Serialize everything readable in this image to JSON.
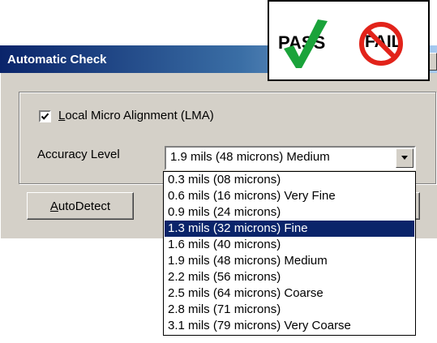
{
  "window": {
    "title": "Automatic Check",
    "close_glyph": "×"
  },
  "lma": {
    "checked": true,
    "label": "Local Micro Alignment (LMA)"
  },
  "accuracy": {
    "label": "Accuracy Level",
    "selected_value": "1.9 mils (48 microns) Medium",
    "options": [
      "0.3 mils (08 microns)",
      "0.6 mils (16 microns) Very Fine",
      "0.9 mils (24 microns)",
      "1.3 mils (32 microns) Fine",
      "1.6 mils (40 microns)",
      "1.9 mils (48 microns) Medium",
      "2.2 mils (56 microns)",
      "2.5 mils (64 microns) Coarse",
      "2.8 mils (71 microns)",
      "3.1 mils (79 microns) Very Coarse"
    ],
    "highlighted_index": 3
  },
  "buttons": {
    "autodetect_label": "AutoDetect"
  },
  "badge": {
    "pass_label": "PASS",
    "fail_label": "FAIL",
    "check_color": "#1aa33a",
    "fail_color": "#e2231a"
  },
  "colors": {
    "title_bar_start": "#0a246a",
    "title_bar_end": "#a6caf0",
    "face": "#d4d0c8",
    "selection": "#0a246a"
  }
}
